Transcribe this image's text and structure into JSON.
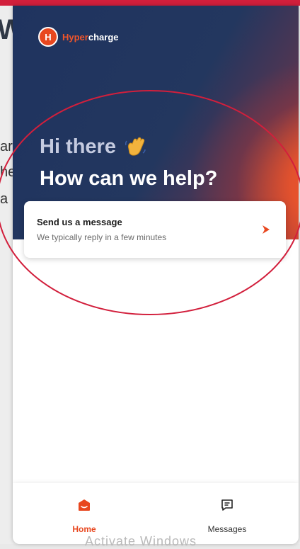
{
  "brand": {
    "mark_letter": "H",
    "name_accent": "Hyper",
    "name_rest": "charge"
  },
  "background_fragments": [
    "W",
    "ar",
    "he",
    "a"
  ],
  "hero": {
    "greeting": "Hi there",
    "greeting_icon": "waving-hand-icon",
    "headline": "How can we help?"
  },
  "message_card": {
    "title": "Send us a message",
    "subtitle": "We typically reply in a few minutes",
    "action_icon": "send-arrow-icon"
  },
  "nav": {
    "home_label": "Home",
    "home_icon": "home-chat-icon",
    "messages_label": "Messages",
    "messages_icon": "messages-icon"
  },
  "watermark": "Activate Windows",
  "colors": {
    "accent": "#e8471f",
    "hero_dark": "#1f335f",
    "annotation": "#d21f3c"
  }
}
